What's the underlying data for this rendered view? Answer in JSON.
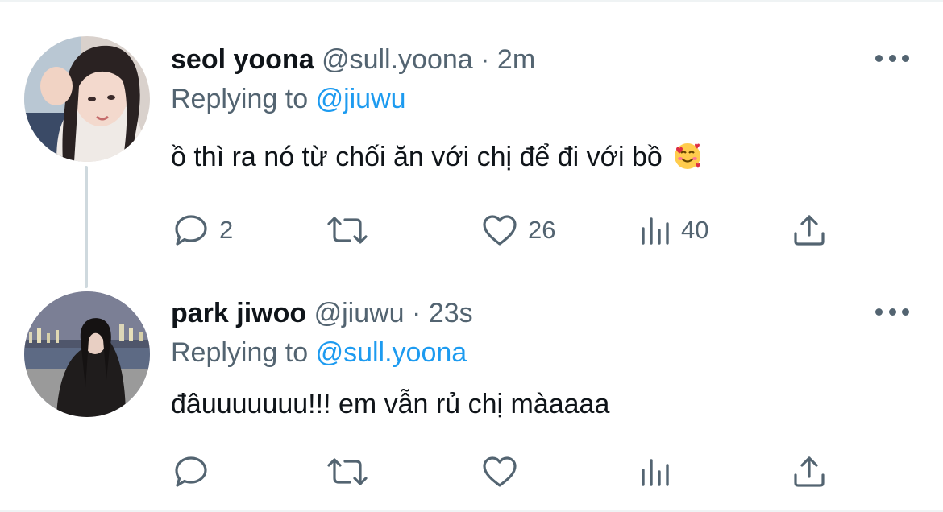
{
  "tweets": [
    {
      "display_name": "seol yoona",
      "handle": "@sull.yoona",
      "separator": "·",
      "time": "2m",
      "replying_prefix": "Replying to",
      "replying_handle": "@jiuwu",
      "text": "ồ thì ra nó từ chối ăn với chị để đi với bồ",
      "emoji": "smiling-face-with-hearts",
      "stats": {
        "replies": "2",
        "retweets": "",
        "likes": "26",
        "views": "40"
      }
    },
    {
      "display_name": "park jiwoo",
      "handle": "@jiuwu",
      "separator": "·",
      "time": "23s",
      "replying_prefix": "Replying to",
      "replying_handle": "@sull.yoona",
      "text": "đâuuuuuuu!!! em vẫn rủ chị màaaaa",
      "stats": {
        "replies": "",
        "retweets": "",
        "likes": "",
        "views": ""
      }
    }
  ],
  "icons": {
    "reply": "reply-bubble-icon",
    "retweet": "retweet-arrows-icon",
    "like": "heart-icon",
    "views": "views-bar-chart-icon",
    "share": "share-upload-icon",
    "more": "more-dots-icon"
  },
  "colors": {
    "text_primary": "#0f1419",
    "text_secondary": "#536471",
    "link": "#1d9bf0",
    "thread_line": "#cfd9de",
    "divider": "#eff3f4"
  }
}
